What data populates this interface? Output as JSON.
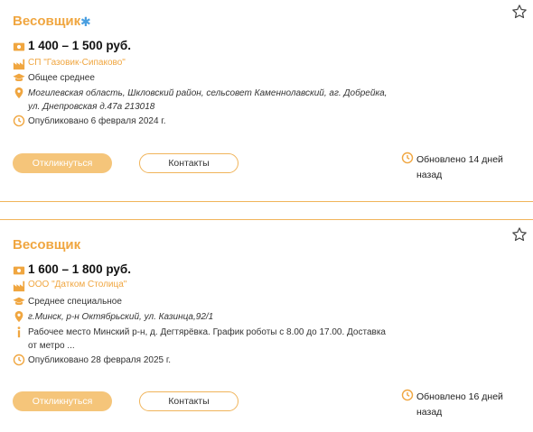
{
  "vacancies": [
    {
      "title": "Весовщик",
      "salary": "1 400 – 1 500 руб.",
      "company": "СП \"Газовик-Сипаково\"",
      "education": "Общее среднее",
      "address": "Могилевская область, Шкловский район, сельсовет Каменнолавский, аг. Добрейка, ул. Днепровская д.47а 213018",
      "published": "Опубликовано 6 февраля 2024 г.",
      "apply_label": "Откликнуться",
      "contacts_label": "Контакты",
      "updated_line1": "Обновлено 14 дней",
      "updated_line2": "назад"
    },
    {
      "title": "Весовщик",
      "salary": "1 600 – 1 800 руб.",
      "company": "ООО \"Датком Столица\"",
      "education": "Среднее специальное",
      "address": "г.Минск, р-н Октябрьский, ул. Казинца,92/1",
      "info": "Рабочее место Минский р-н, д. Дегтярёвка. График роботы с 8.00 до 17.00. Доставка от метро ...",
      "published": "Опубликовано 28 февраля 2025 г.",
      "apply_label": "Откликнуться",
      "contacts_label": "Контакты",
      "updated_line1": "Обновлено 16 дней",
      "updated_line2": "назад"
    }
  ],
  "colors": {
    "accent": "#f0a640",
    "button_fill": "#f5c57a",
    "sparkle": "#4a9fe0"
  },
  "icons": [
    "sparkle-icon",
    "star-icon",
    "money-icon",
    "factory-icon",
    "graduation-cap-icon",
    "location-pin-icon",
    "clock-icon",
    "info-icon"
  ]
}
